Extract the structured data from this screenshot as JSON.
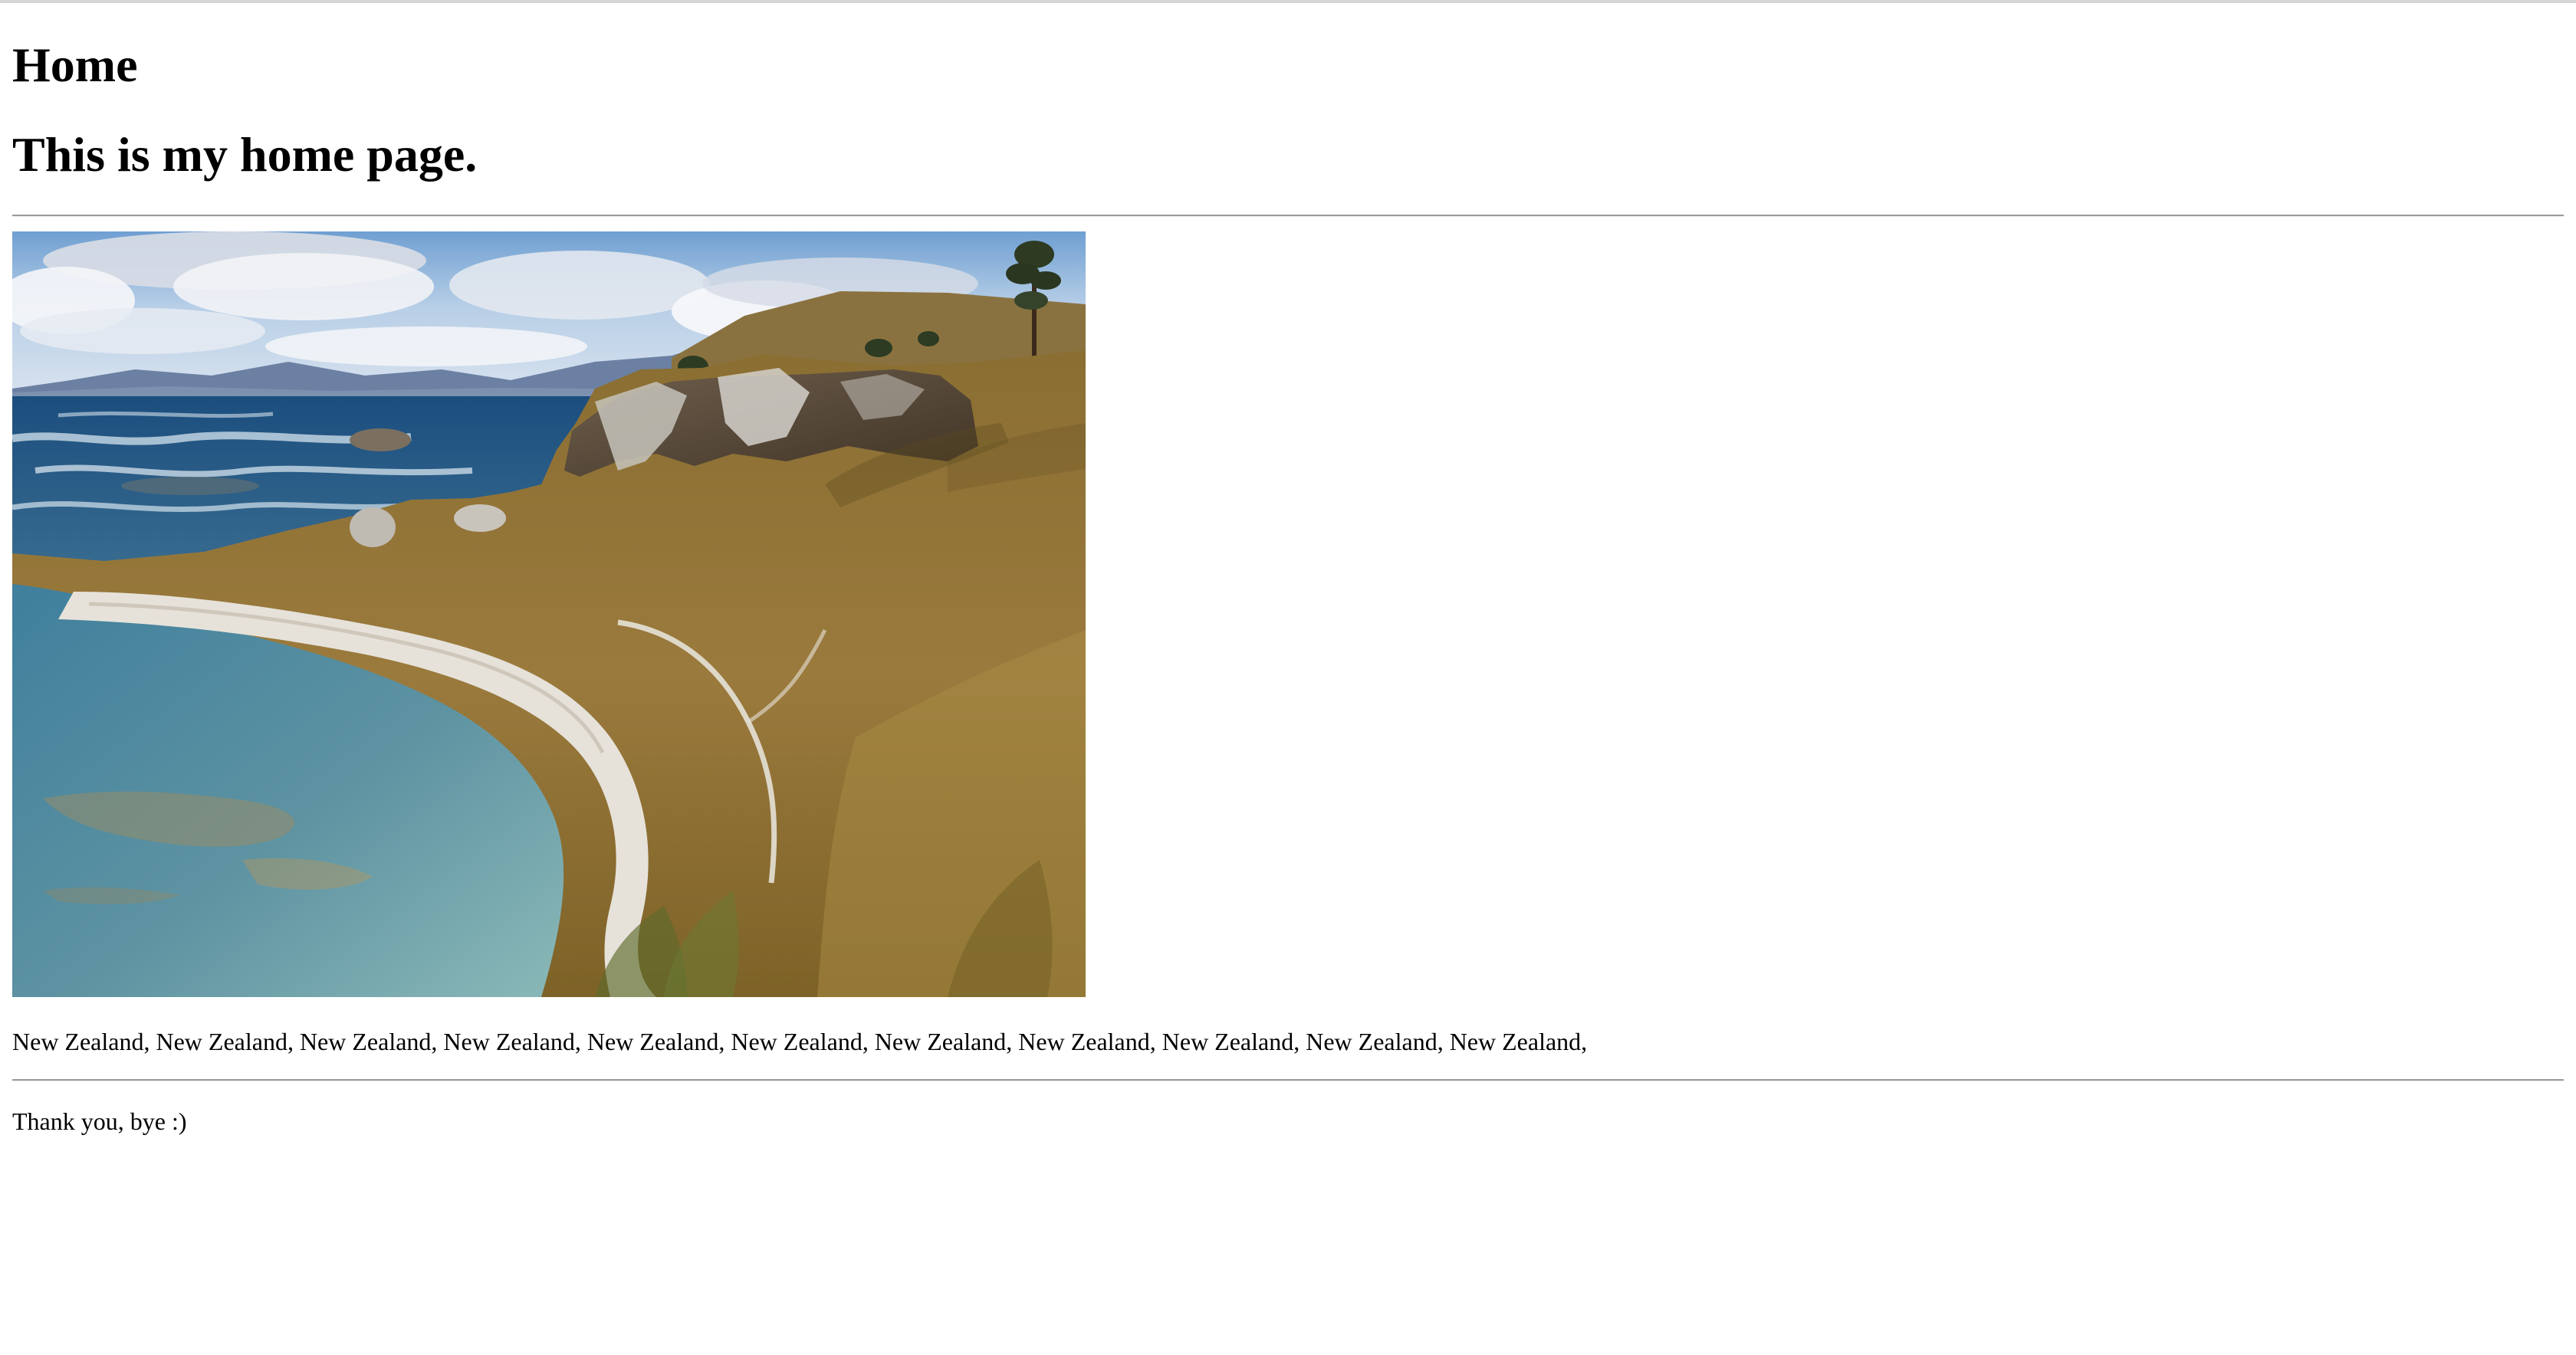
{
  "page": {
    "title": "Home",
    "subtitle": "This is my home page.",
    "places_text": "New Zealand, New Zealand, New Zealand, New Zealand, New Zealand, New Zealand, New Zealand, New Zealand, New Zealand, New Zealand, New Zealand,",
    "closing_text": "Thank you, bye :)"
  }
}
